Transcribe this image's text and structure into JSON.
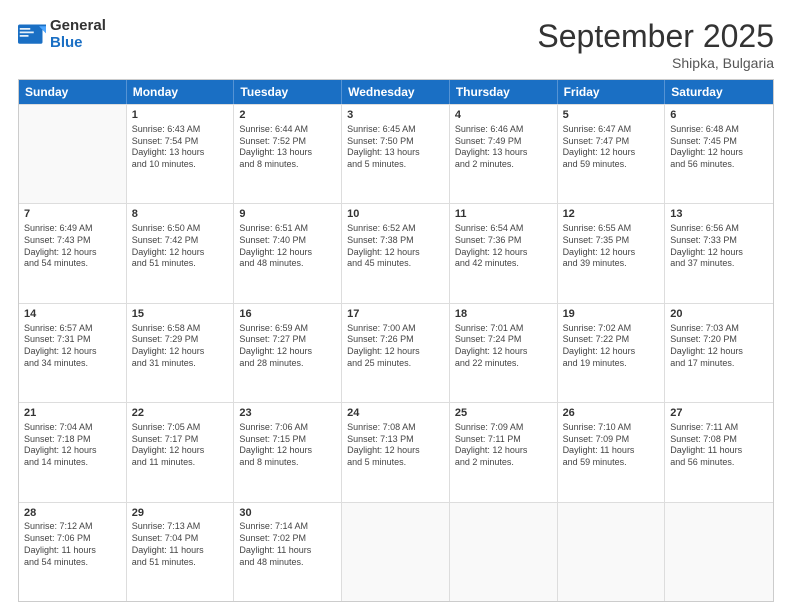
{
  "header": {
    "logo_general": "General",
    "logo_blue": "Blue",
    "month_title": "September 2025",
    "location": "Shipka, Bulgaria"
  },
  "weekdays": [
    "Sunday",
    "Monday",
    "Tuesday",
    "Wednesday",
    "Thursday",
    "Friday",
    "Saturday"
  ],
  "rows": [
    [
      {
        "day": "",
        "lines": []
      },
      {
        "day": "1",
        "lines": [
          "Sunrise: 6:43 AM",
          "Sunset: 7:54 PM",
          "Daylight: 13 hours",
          "and 10 minutes."
        ]
      },
      {
        "day": "2",
        "lines": [
          "Sunrise: 6:44 AM",
          "Sunset: 7:52 PM",
          "Daylight: 13 hours",
          "and 8 minutes."
        ]
      },
      {
        "day": "3",
        "lines": [
          "Sunrise: 6:45 AM",
          "Sunset: 7:50 PM",
          "Daylight: 13 hours",
          "and 5 minutes."
        ]
      },
      {
        "day": "4",
        "lines": [
          "Sunrise: 6:46 AM",
          "Sunset: 7:49 PM",
          "Daylight: 13 hours",
          "and 2 minutes."
        ]
      },
      {
        "day": "5",
        "lines": [
          "Sunrise: 6:47 AM",
          "Sunset: 7:47 PM",
          "Daylight: 12 hours",
          "and 59 minutes."
        ]
      },
      {
        "day": "6",
        "lines": [
          "Sunrise: 6:48 AM",
          "Sunset: 7:45 PM",
          "Daylight: 12 hours",
          "and 56 minutes."
        ]
      }
    ],
    [
      {
        "day": "7",
        "lines": [
          "Sunrise: 6:49 AM",
          "Sunset: 7:43 PM",
          "Daylight: 12 hours",
          "and 54 minutes."
        ]
      },
      {
        "day": "8",
        "lines": [
          "Sunrise: 6:50 AM",
          "Sunset: 7:42 PM",
          "Daylight: 12 hours",
          "and 51 minutes."
        ]
      },
      {
        "day": "9",
        "lines": [
          "Sunrise: 6:51 AM",
          "Sunset: 7:40 PM",
          "Daylight: 12 hours",
          "and 48 minutes."
        ]
      },
      {
        "day": "10",
        "lines": [
          "Sunrise: 6:52 AM",
          "Sunset: 7:38 PM",
          "Daylight: 12 hours",
          "and 45 minutes."
        ]
      },
      {
        "day": "11",
        "lines": [
          "Sunrise: 6:54 AM",
          "Sunset: 7:36 PM",
          "Daylight: 12 hours",
          "and 42 minutes."
        ]
      },
      {
        "day": "12",
        "lines": [
          "Sunrise: 6:55 AM",
          "Sunset: 7:35 PM",
          "Daylight: 12 hours",
          "and 39 minutes."
        ]
      },
      {
        "day": "13",
        "lines": [
          "Sunrise: 6:56 AM",
          "Sunset: 7:33 PM",
          "Daylight: 12 hours",
          "and 37 minutes."
        ]
      }
    ],
    [
      {
        "day": "14",
        "lines": [
          "Sunrise: 6:57 AM",
          "Sunset: 7:31 PM",
          "Daylight: 12 hours",
          "and 34 minutes."
        ]
      },
      {
        "day": "15",
        "lines": [
          "Sunrise: 6:58 AM",
          "Sunset: 7:29 PM",
          "Daylight: 12 hours",
          "and 31 minutes."
        ]
      },
      {
        "day": "16",
        "lines": [
          "Sunrise: 6:59 AM",
          "Sunset: 7:27 PM",
          "Daylight: 12 hours",
          "and 28 minutes."
        ]
      },
      {
        "day": "17",
        "lines": [
          "Sunrise: 7:00 AM",
          "Sunset: 7:26 PM",
          "Daylight: 12 hours",
          "and 25 minutes."
        ]
      },
      {
        "day": "18",
        "lines": [
          "Sunrise: 7:01 AM",
          "Sunset: 7:24 PM",
          "Daylight: 12 hours",
          "and 22 minutes."
        ]
      },
      {
        "day": "19",
        "lines": [
          "Sunrise: 7:02 AM",
          "Sunset: 7:22 PM",
          "Daylight: 12 hours",
          "and 19 minutes."
        ]
      },
      {
        "day": "20",
        "lines": [
          "Sunrise: 7:03 AM",
          "Sunset: 7:20 PM",
          "Daylight: 12 hours",
          "and 17 minutes."
        ]
      }
    ],
    [
      {
        "day": "21",
        "lines": [
          "Sunrise: 7:04 AM",
          "Sunset: 7:18 PM",
          "Daylight: 12 hours",
          "and 14 minutes."
        ]
      },
      {
        "day": "22",
        "lines": [
          "Sunrise: 7:05 AM",
          "Sunset: 7:17 PM",
          "Daylight: 12 hours",
          "and 11 minutes."
        ]
      },
      {
        "day": "23",
        "lines": [
          "Sunrise: 7:06 AM",
          "Sunset: 7:15 PM",
          "Daylight: 12 hours",
          "and 8 minutes."
        ]
      },
      {
        "day": "24",
        "lines": [
          "Sunrise: 7:08 AM",
          "Sunset: 7:13 PM",
          "Daylight: 12 hours",
          "and 5 minutes."
        ]
      },
      {
        "day": "25",
        "lines": [
          "Sunrise: 7:09 AM",
          "Sunset: 7:11 PM",
          "Daylight: 12 hours",
          "and 2 minutes."
        ]
      },
      {
        "day": "26",
        "lines": [
          "Sunrise: 7:10 AM",
          "Sunset: 7:09 PM",
          "Daylight: 11 hours",
          "and 59 minutes."
        ]
      },
      {
        "day": "27",
        "lines": [
          "Sunrise: 7:11 AM",
          "Sunset: 7:08 PM",
          "Daylight: 11 hours",
          "and 56 minutes."
        ]
      }
    ],
    [
      {
        "day": "28",
        "lines": [
          "Sunrise: 7:12 AM",
          "Sunset: 7:06 PM",
          "Daylight: 11 hours",
          "and 54 minutes."
        ]
      },
      {
        "day": "29",
        "lines": [
          "Sunrise: 7:13 AM",
          "Sunset: 7:04 PM",
          "Daylight: 11 hours",
          "and 51 minutes."
        ]
      },
      {
        "day": "30",
        "lines": [
          "Sunrise: 7:14 AM",
          "Sunset: 7:02 PM",
          "Daylight: 11 hours",
          "and 48 minutes."
        ]
      },
      {
        "day": "",
        "lines": []
      },
      {
        "day": "",
        "lines": []
      },
      {
        "day": "",
        "lines": []
      },
      {
        "day": "",
        "lines": []
      }
    ]
  ]
}
